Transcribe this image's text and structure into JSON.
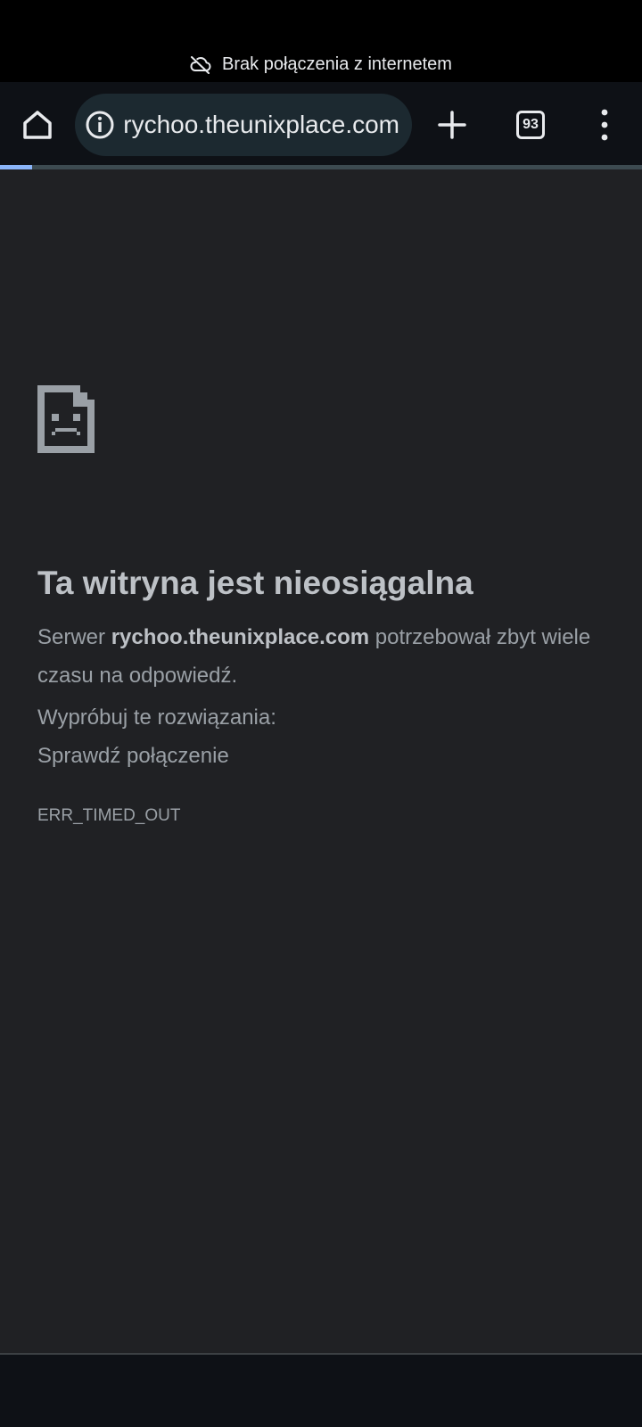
{
  "status_bar": {
    "offline_text": "Brak połączenia z internetem",
    "icon": "cloud-off-icon"
  },
  "toolbar": {
    "home_icon": "home-icon",
    "omnibox": {
      "security_icon": "info-icon",
      "url": "rychoo.theunixplace.com"
    },
    "new_tab_icon": "plus-icon",
    "tab_count": "93",
    "menu_icon": "more-vertical-icon"
  },
  "progress": {
    "value": 0.05,
    "color": "#8ab4f8"
  },
  "error_page": {
    "icon": "sad-page-icon",
    "title": "Ta witryna jest nieosiągalna",
    "desc_prefix": "Serwer ",
    "desc_host": "rychoo.theunixplace.com",
    "desc_suffix": " potrzebował zbyt wiele czasu na odpowiedź.",
    "suggestions_heading": "Wypróbuj te rozwiązania:",
    "suggestions": [
      "Sprawdź połączenie"
    ],
    "error_code": "ERR_TIMED_OUT"
  },
  "colors": {
    "background": "#202124",
    "toolbar": "#0e1116",
    "omnibox": "#1c2930",
    "accent": "#8ab4f8"
  }
}
